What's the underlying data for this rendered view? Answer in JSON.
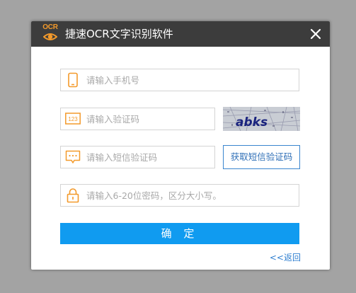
{
  "window": {
    "logo_text": "OCR",
    "title": "捷速OCR文字识别软件",
    "close_icon": "close-icon"
  },
  "form": {
    "phone": {
      "placeholder": "请输入手机号",
      "value": "",
      "icon": "phone-icon"
    },
    "captcha": {
      "placeholder": "请输入验证码",
      "value": "",
      "icon": "numeric-code-icon",
      "image_text": "abks"
    },
    "sms_code": {
      "placeholder": "请输入短信验证码",
      "value": "",
      "icon": "message-icon",
      "button_label": "获取短信验证码"
    },
    "password": {
      "placeholder": "请输入6-20位密码，区分大小写。",
      "value": "",
      "icon": "lock-icon"
    }
  },
  "actions": {
    "confirm_label": "确 定",
    "back_label": "<<返回"
  },
  "colors": {
    "titlebar": "#3c3c3c",
    "accent_orange": "#f39a2b",
    "primary_blue": "#109bf0",
    "link_blue": "#2f7fd0"
  }
}
